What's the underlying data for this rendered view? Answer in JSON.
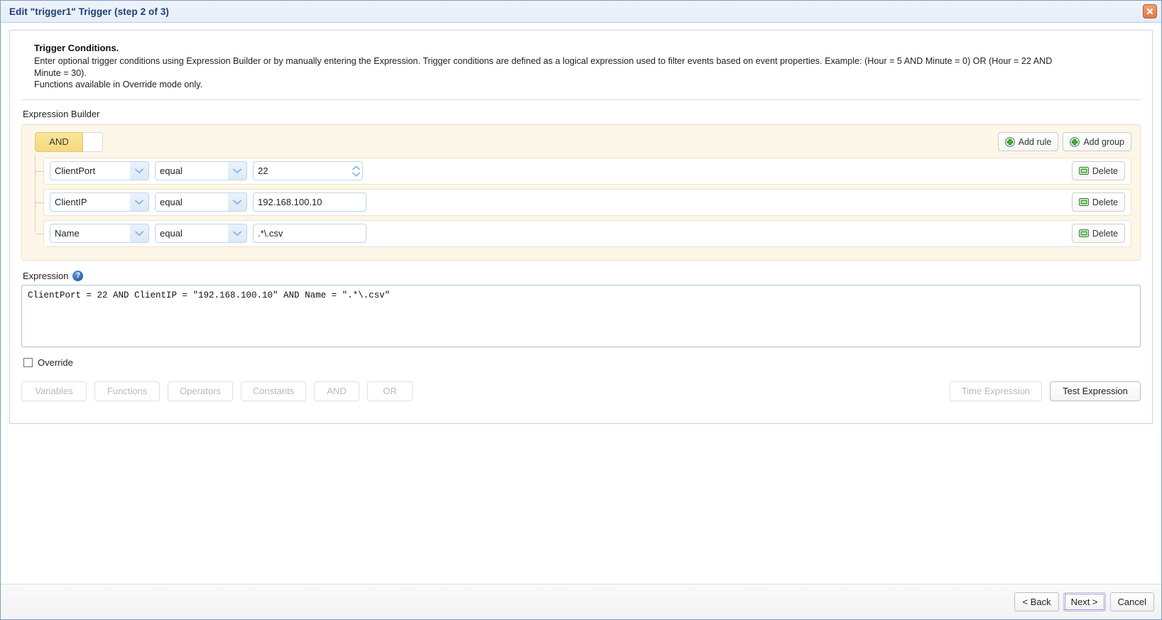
{
  "window": {
    "title": "Edit \"trigger1\" Trigger (step 2 of 3)",
    "close_icon": "close-icon"
  },
  "intro": {
    "heading": "Trigger Conditions.",
    "paragraph": "Enter optional trigger conditions using Expression Builder or by manually entering the Expression. Trigger conditions are defined as a logical expression used to filter events based on event properties. Example: (Hour = 5 AND Minute = 0) OR (Hour = 22 AND Minute = 30).",
    "note": "Functions available in Override mode only."
  },
  "builder": {
    "label": "Expression Builder",
    "condition_selected": "AND",
    "condition_other": "",
    "add_rule_label": "Add rule",
    "add_group_label": "Add group",
    "delete_label": "Delete",
    "rules": [
      {
        "field": "ClientPort",
        "operator": "equal",
        "value": "22",
        "value_type": "number"
      },
      {
        "field": "ClientIP",
        "operator": "equal",
        "value": "192.168.100.10",
        "value_type": "text"
      },
      {
        "field": "Name",
        "operator": "equal",
        "value": ".*\\.csv",
        "value_type": "text"
      }
    ]
  },
  "expression": {
    "label": "Expression",
    "help_icon": "help-icon",
    "value": "ClientPort = 22 AND ClientIP = \"192.168.100.10\" AND Name = \".*\\.csv\"",
    "placeholder": ""
  },
  "override": {
    "label": "Override",
    "checked": false
  },
  "toolbar": {
    "variables_label": "Variables",
    "functions_label": "Functions",
    "operators_label": "Operators",
    "constants_label": "Constants",
    "and_label": "AND",
    "or_label": "OR",
    "time_expression_label": "Time Expression",
    "test_expression_label": "Test Expression"
  },
  "footer": {
    "back_label": "< Back",
    "next_label": "Next >",
    "cancel_label": "Cancel"
  },
  "colors": {
    "title_text": "#1c3f73",
    "builder_bg": "#fdf7e9",
    "condition_and": "#f6d97e",
    "close_button": "#dd7b4a",
    "add_icon_green": "#3f9b35",
    "help_blue": "#2f6fb5"
  }
}
